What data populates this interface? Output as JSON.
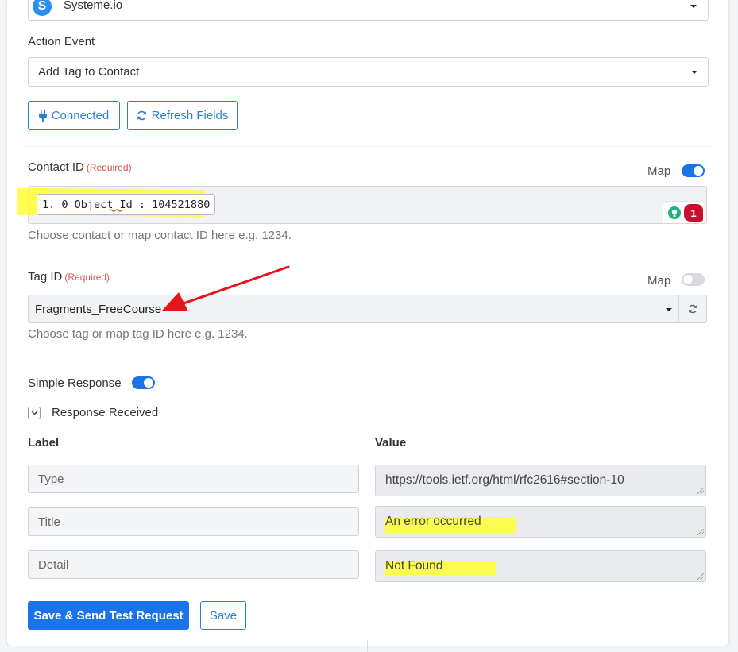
{
  "app_select": {
    "value": "Systeme.io",
    "logo_letter": "S",
    "logo_color": "#2a8ef0"
  },
  "action_event": {
    "label": "Action Event",
    "value": "Add Tag to Contact"
  },
  "buttons": {
    "connected": "Connected",
    "refresh_fields": "Refresh Fields",
    "save_send": "Save & Send Test Request",
    "save": "Save"
  },
  "contact_id": {
    "label": "Contact ID",
    "required": "(Required)",
    "map_label": "Map",
    "map_on": true,
    "chip": "1. 0 Object Id : 104521880",
    "hint": "Choose contact or map contact ID here e.g. 1234.",
    "badge_count": "1"
  },
  "tag_id": {
    "label": "Tag ID",
    "required": "(Required)",
    "map_label": "Map",
    "map_on": false,
    "value": "Fragments_FreeCourse",
    "hint": "Choose tag or map tag ID here e.g. 1234."
  },
  "simple_response": {
    "label": "Simple Response",
    "on": true
  },
  "response_received": {
    "label": "Response Received"
  },
  "response_table": {
    "label_header": "Label",
    "value_header": "Value",
    "rows": [
      {
        "label": "Type",
        "value": "https://tools.ietf.org/html/rfc2616#section-10"
      },
      {
        "label": "Title",
        "value": "An error occurred"
      },
      {
        "label": "Detail",
        "value": "Not Found"
      }
    ]
  },
  "colors": {
    "primary": "#1a73e8",
    "required": "#d9534f",
    "highlight": "#ffff33",
    "arrow": "#e8141b",
    "badge": "#c8102e"
  }
}
